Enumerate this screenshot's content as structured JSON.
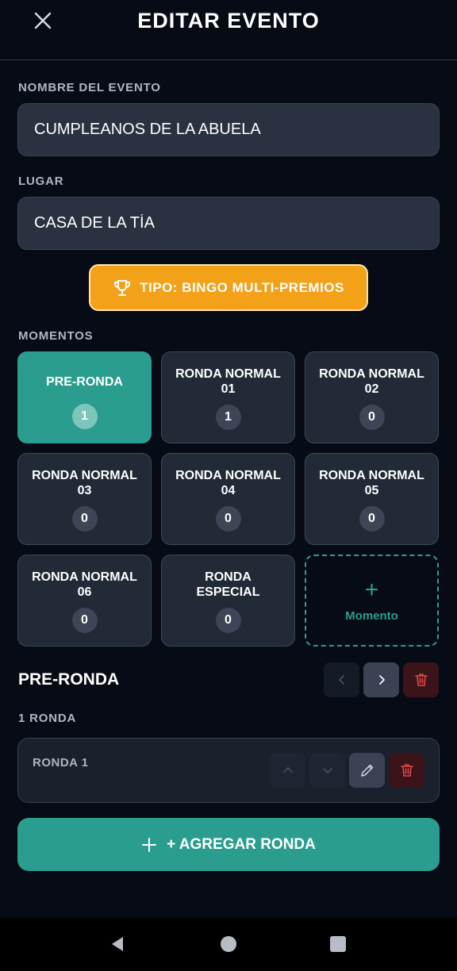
{
  "header": {
    "title": "EDITAR EVENTO",
    "close_icon": "close-icon"
  },
  "form": {
    "name_label": "NOMBRE DEL EVENTO",
    "name_value": "CUMPLEANOS DE LA ABUELA",
    "place_label": "LUGAR",
    "place_value": "CASA DE LA TÍA"
  },
  "type_button": {
    "label": "TIPO: BINGO MULTI-PREMIOS",
    "icon": "trophy-icon",
    "color": "#f4a11a"
  },
  "moments": {
    "label": "MOMENTOS",
    "items": [
      {
        "name": "PRE-RONDA",
        "count": "1",
        "active": true
      },
      {
        "name": "RONDA NORMAL 01",
        "count": "1"
      },
      {
        "name": "RONDA NORMAL 02",
        "count": "0"
      },
      {
        "name": "RONDA NORMAL 03",
        "count": "0"
      },
      {
        "name": "RONDA NORMAL 04",
        "count": "0"
      },
      {
        "name": "RONDA NORMAL 05",
        "count": "0"
      },
      {
        "name": "RONDA NORMAL 06",
        "count": "0"
      },
      {
        "name": "RONDA ESPECIAL",
        "count": "0"
      }
    ],
    "add_label": "Momento",
    "accent": "#2a9d8f"
  },
  "selected": {
    "title": "PRE-RONDA",
    "rounds_count_label": "1 RONDA",
    "rounds": [
      {
        "name": "RONDA 1"
      }
    ]
  },
  "add_round": {
    "label": "+ AGREGAR RONDA"
  },
  "navbar": {
    "back_icon": "back-triangle-icon",
    "home_icon": "home-circle-icon",
    "recents_icon": "recents-square-icon"
  }
}
